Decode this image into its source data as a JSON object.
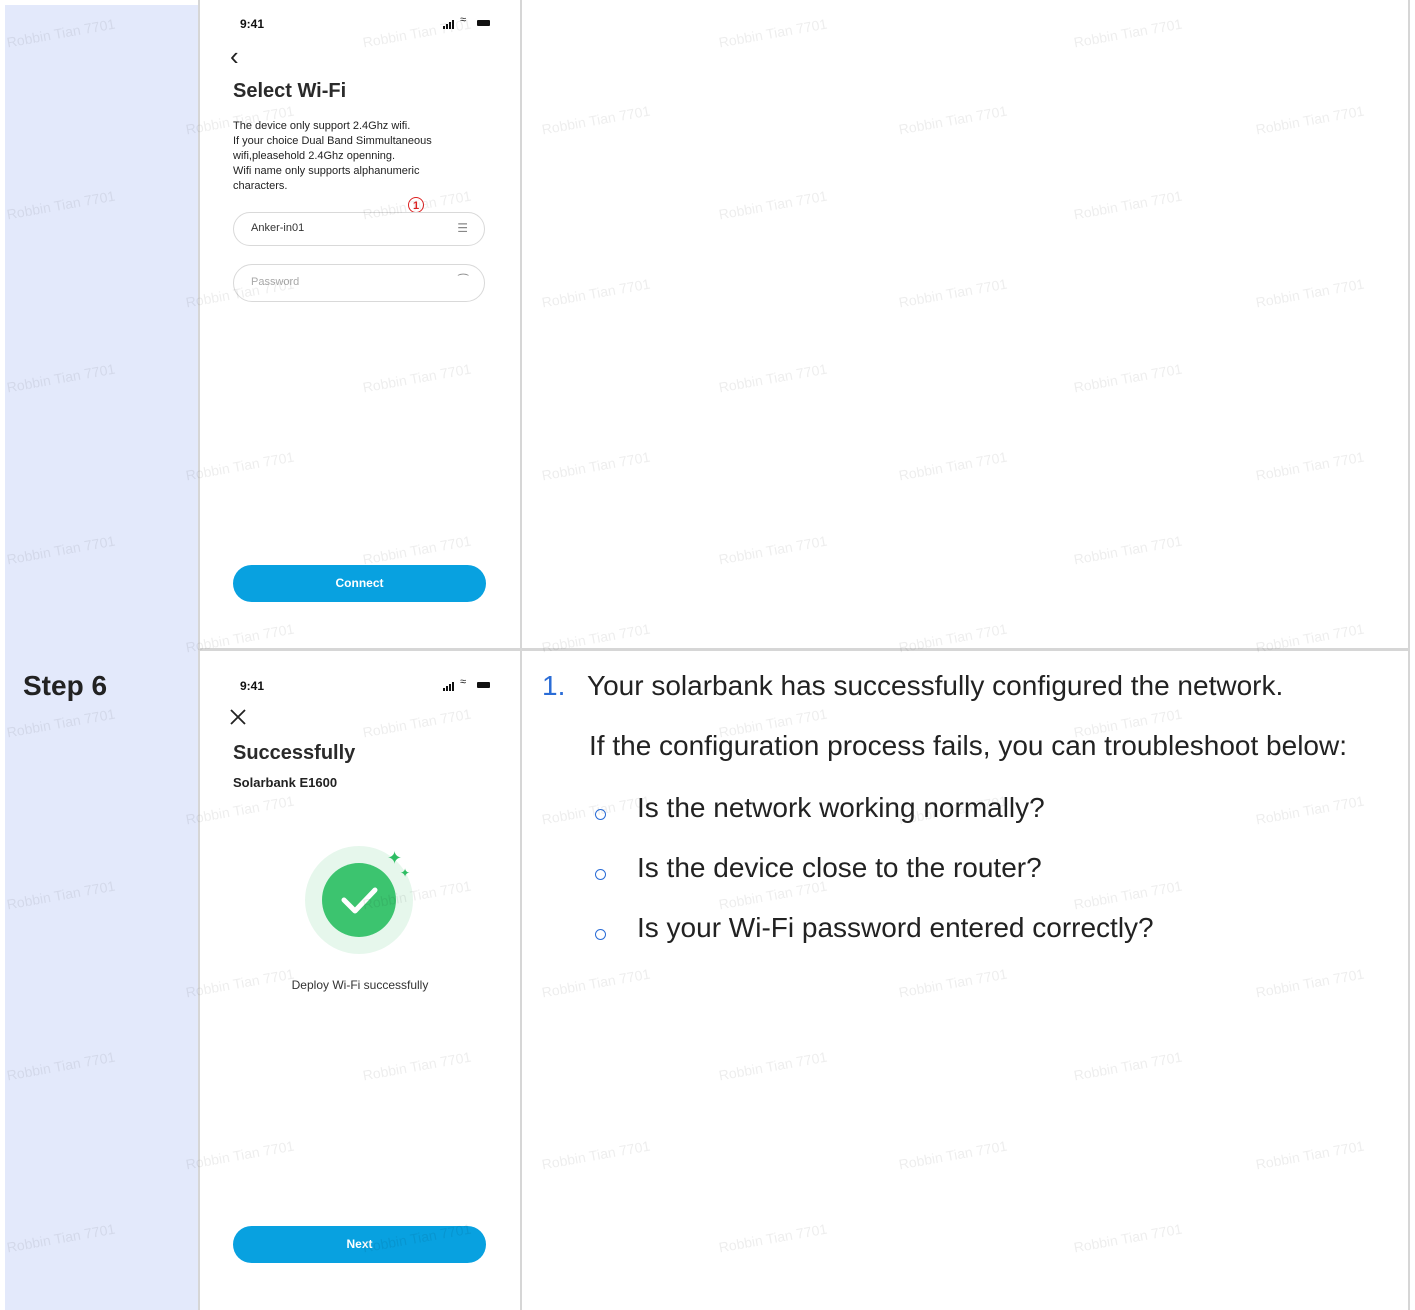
{
  "step_label": "Step 6",
  "watermark": "Robbin Tian 7701",
  "screen_select_wifi": {
    "time": "9:41",
    "title": "Select Wi-Fi",
    "info_lines": [
      "The device only support 2.4Ghz wifi.",
      "If your choice Dual Band Simmultaneous",
      "wifi,pleasehold 2.4Ghz openning.",
      "Wifi name only supports alphanumeric",
      "characters."
    ],
    "marker": "1",
    "wifi_name_value": "Anker-in01",
    "password_placeholder": "Password",
    "connect_label": "Connect"
  },
  "screen_success": {
    "time": "9:41",
    "title": "Successfully",
    "subtitle": "Solarbank E1600",
    "deploy_text": "Deploy Wi-Fi successfully",
    "next_label": "Next"
  },
  "instructions": {
    "number": "1.",
    "main": "Your solarbank has successfully configured the network.",
    "troubleshoot": "If the configuration process fails, you can troubleshoot below:",
    "checks": [
      "Is the network working normally?",
      "Is the device close to the router?",
      "Is your Wi-Fi password entered correctly?"
    ]
  },
  "colors": {
    "label_column_bg": "#e3e9fb",
    "button_blue": "#08a1e0",
    "success_green": "#3cc46f",
    "number_blue": "#2a6cd6"
  }
}
